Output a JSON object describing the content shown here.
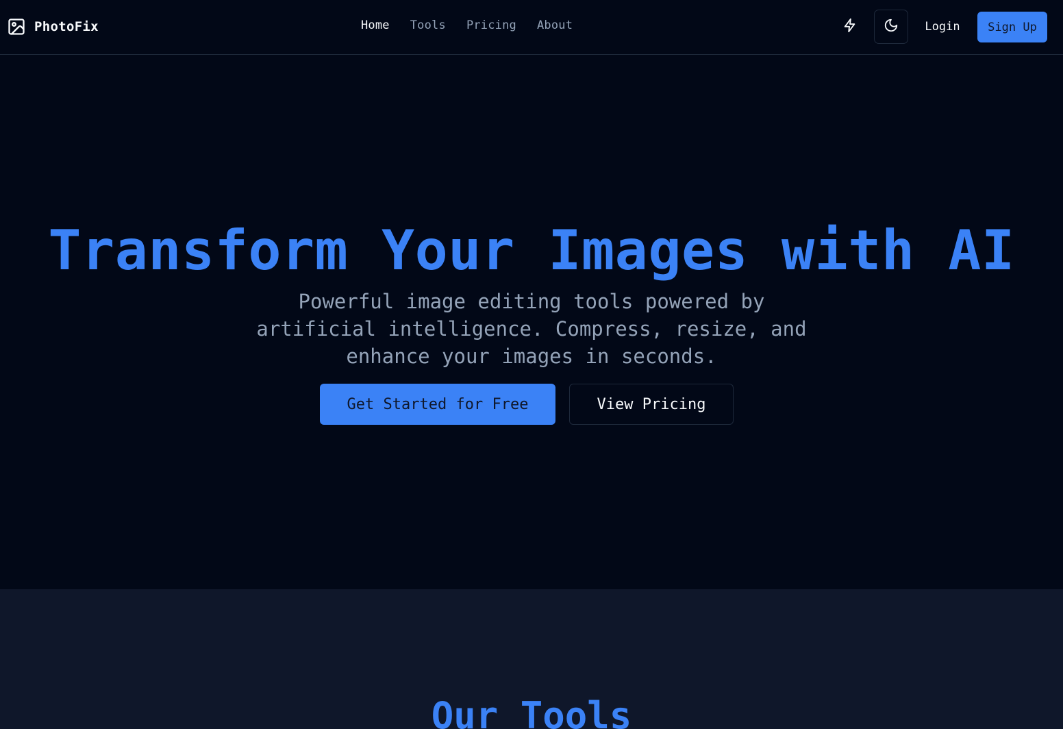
{
  "header": {
    "logo_icon": "image-icon",
    "logo_text": "PhotoFix",
    "nav": [
      {
        "label": "Home",
        "active": true
      },
      {
        "label": "Tools",
        "active": false
      },
      {
        "label": "Pricing",
        "active": false
      },
      {
        "label": "About",
        "active": false
      }
    ],
    "bolt_icon": "lightning-bolt-icon",
    "theme_icon": "moon-icon",
    "login_label": "Login",
    "signup_label": "Sign Up"
  },
  "hero": {
    "title": "Transform Your Images with AI",
    "subtitle": "Powerful image editing tools powered by artificial intelligence. Compress, resize, and enhance your images in seconds.",
    "primary_cta": "Get Started for Free",
    "secondary_cta": "View Pricing"
  },
  "tools": {
    "heading": "Our Tools"
  },
  "colors": {
    "background": "#020817",
    "section_background": "#0f172a",
    "accent": "#3b82f6",
    "muted_text": "#94a3b8",
    "border": "#1e293b"
  }
}
